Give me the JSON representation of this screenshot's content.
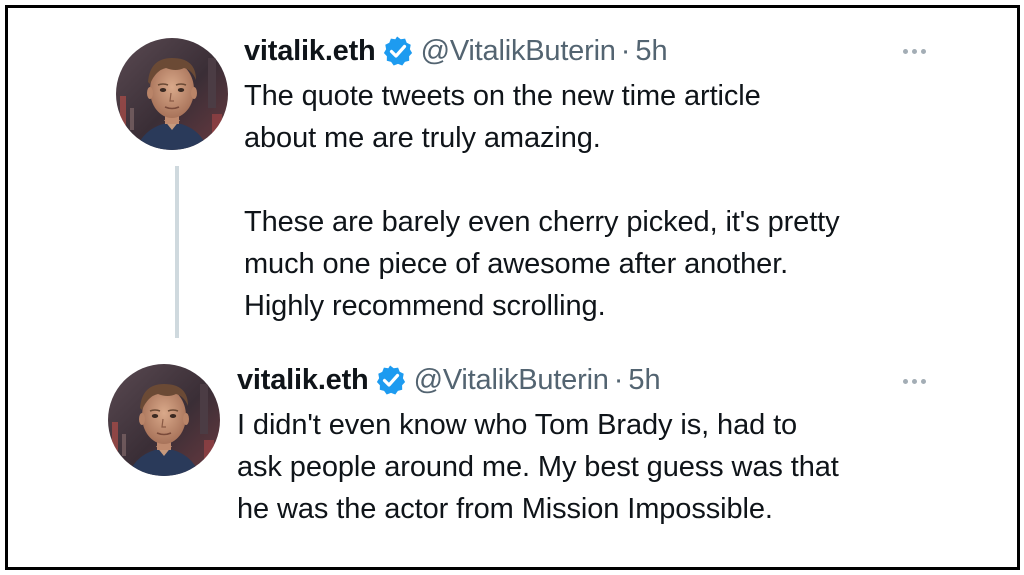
{
  "tweets": [
    {
      "display_name": "vitalik.eth",
      "verified_icon": "verified-badge-icon",
      "handle": "@VitalikButerin",
      "separator": "·",
      "time": "5h",
      "more_icon": "more-options-icon",
      "lines": [
        "The quote tweets on the new time article",
        "about me are truly amazing.",
        "",
        "These are barely even cherry picked, it's pretty",
        "much one piece of awesome after another.",
        "Highly recommend scrolling."
      ]
    },
    {
      "display_name": "vitalik.eth",
      "verified_icon": "verified-badge-icon",
      "handle": "@VitalikButerin",
      "separator": "·",
      "time": "5h",
      "more_icon": "more-options-icon",
      "lines": [
        "I didn't even know who Tom Brady is, had to",
        "ask people around me. My best guess was that",
        "he was the actor from Mission Impossible."
      ]
    }
  ],
  "colors": {
    "text_primary": "#0f1419",
    "text_secondary": "#536471",
    "verified_blue": "#1d9bf0",
    "thread_line": "#cfd9de",
    "frame_border": "#000000"
  }
}
